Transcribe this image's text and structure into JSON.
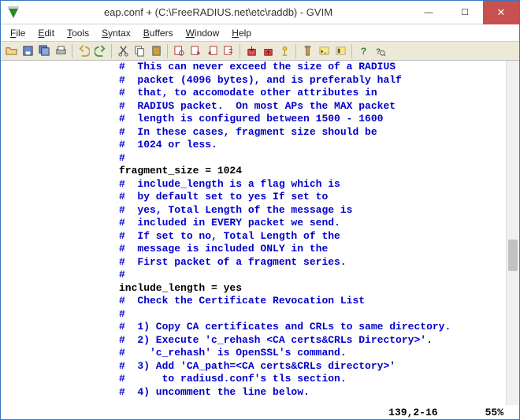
{
  "window": {
    "title": "eap.conf + (C:\\FreeRADIUS.net\\etc\\raddb) - GVIM"
  },
  "menu": {
    "file": {
      "u": "F",
      "rest": "ile"
    },
    "edit": {
      "u": "E",
      "rest": "dit"
    },
    "tools": {
      "u": "T",
      "rest": "ools"
    },
    "syntax": {
      "u": "S",
      "rest": "yntax"
    },
    "buffers": {
      "u": "B",
      "rest": "uffers"
    },
    "window": {
      "u": "W",
      "rest": "indow"
    },
    "help": {
      "u": "H",
      "rest": "elp"
    }
  },
  "status": {
    "position": "139,2-16",
    "percent": "55%"
  },
  "code": {
    "lines": [
      {
        "t": "com",
        "text": "#  This can never exceed the size of a RADIUS"
      },
      {
        "t": "com",
        "text": "#  packet (4096 bytes), and is preferably half"
      },
      {
        "t": "com",
        "text": "#  that, to accomodate other attributes in"
      },
      {
        "t": "com",
        "text": "#  RADIUS packet.  On most APs the MAX packet"
      },
      {
        "t": "com",
        "text": "#  length is configured between 1500 - 1600"
      },
      {
        "t": "com",
        "text": "#  In these cases, fragment size should be"
      },
      {
        "t": "com",
        "text": "#  1024 or less."
      },
      {
        "t": "com",
        "text": "#"
      },
      {
        "t": "stmt",
        "text": "fragment_size = 1024"
      },
      {
        "t": "stmt",
        "text": ""
      },
      {
        "t": "com",
        "text": "#  include_length is a flag which is"
      },
      {
        "t": "com",
        "text": "#  by default set to yes If set to"
      },
      {
        "t": "com",
        "text": "#  yes, Total Length of the message is"
      },
      {
        "t": "com",
        "text": "#  included in EVERY packet we send."
      },
      {
        "t": "com",
        "text": "#  If set to no, Total Length of the"
      },
      {
        "t": "com",
        "text": "#  message is included ONLY in the"
      },
      {
        "t": "com",
        "text": "#  First packet of a fragment series."
      },
      {
        "t": "com",
        "text": "#"
      },
      {
        "t": "stmt",
        "text": "include_length = yes"
      },
      {
        "t": "stmt",
        "text": ""
      },
      {
        "t": "com",
        "text": "#  Check the Certificate Revocation List"
      },
      {
        "t": "com",
        "text": "#"
      },
      {
        "t": "com",
        "text": "#  1) Copy CA certificates and CRLs to same directory."
      },
      {
        "t": "com",
        "text": "#  2) Execute 'c_rehash <CA certs&CRLs Directory>'."
      },
      {
        "t": "com",
        "text": "#    'c_rehash' is OpenSSL's command."
      },
      {
        "t": "com",
        "text": "#  3) Add 'CA_path=<CA certs&CRLs directory>'"
      },
      {
        "t": "com",
        "text": "#      to radiusd.conf's tls section."
      },
      {
        "t": "com",
        "text": "#  4) uncomment the line below."
      }
    ]
  }
}
